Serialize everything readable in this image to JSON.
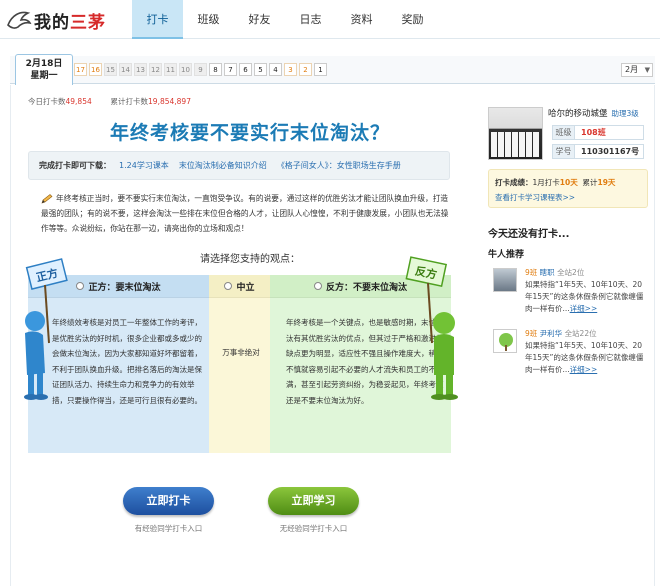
{
  "logo": {
    "text_a": "我的",
    "text_b": "三茅"
  },
  "nav": [
    "打卡",
    "班级",
    "好友",
    "日志",
    "资料",
    "奖励"
  ],
  "datebar": {
    "current_date": "2月18日",
    "current_weekday": "星期一",
    "days": [
      {
        "n": "17",
        "s": "orange"
      },
      {
        "n": "16",
        "s": "orange"
      },
      {
        "n": "15",
        "s": "grey"
      },
      {
        "n": "14",
        "s": "grey"
      },
      {
        "n": "13",
        "s": "grey"
      },
      {
        "n": "12",
        "s": "grey"
      },
      {
        "n": "11",
        "s": "grey"
      },
      {
        "n": "10",
        "s": "grey"
      },
      {
        "n": "9",
        "s": "grey"
      },
      {
        "n": "8",
        "s": "white"
      },
      {
        "n": "7",
        "s": "white"
      },
      {
        "n": "6",
        "s": "white"
      },
      {
        "n": "5",
        "s": "white"
      },
      {
        "n": "4",
        "s": "white"
      },
      {
        "n": "3",
        "s": "orange"
      },
      {
        "n": "2",
        "s": "orange"
      },
      {
        "n": "1",
        "s": "white"
      }
    ],
    "month": "2月"
  },
  "stats": {
    "today_label": "今日打卡数",
    "today_value": "49,854",
    "total_label": "累计打卡数",
    "total_value": "19,854,897"
  },
  "headline": "年终考核要不要实行末位淘汰？",
  "download": {
    "label": "完成打卡即可下载：",
    "links": [
      "1.24学习课本",
      "末位淘汰制必备知识介绍",
      "《格子间女人》：女性职场生存手册"
    ]
  },
  "intro": "年终考核正当时，要不要实行末位淘汰，一直饱受争议。有的说要，通过这样的优胜劣汰才能让团队换血升级，打造最强的团队；有的说不要，这样会淘汰一些排在末位但合格的人才，让团队人心惶惶，不利于健康发展，小团队也无法操作等等。众说纷纭，你站在那一边，请亮出你的立场和观点！",
  "choose": "请选择您支持的观点：",
  "debate": {
    "aff": {
      "title": "正方：要末位淘汰",
      "sign": "正方",
      "body": "年终绩效考核是对员工一年整体工作的考评，是优胜劣汰的好时机，很多企业都或多或少的会做末位淘汰，因为大家都知道好坏都留着，不利于团队换血升级。把排名落后的淘汰是保证团队活力、持续生命力和竞争力的有效举措，只要操作得当，还是可行且很有必要的。"
    },
    "neu": {
      "title": "中立",
      "body": "万事非绝对"
    },
    "neg": {
      "title": "反方：不要末位淘汰",
      "sign": "反方",
      "body": "年终考核是一个关键点，也是敏感时期，末位淘汰有其优胜劣汰的优点，但其过于严格和激进的缺点更为明显，适应性不强且操作难度大，稍有不慎就容易引起不必要的人才流失和员工的不满，甚至引起劳资纠纷，为稳妥起见，年终考核还是不要末位淘汰为好。"
    }
  },
  "buttons": {
    "checkin": "立即打卡",
    "study": "立即学习",
    "hint1": "有经验同学打卡入口",
    "hint2": "无经验同学打卡入口"
  },
  "sidebar": {
    "name": "哈尔的移动城堡",
    "assist": "助理3级",
    "class_key": "班级",
    "class_val": "108班",
    "id_key": "学号",
    "id_val": "110301167号",
    "score_label": "打卡成绩：",
    "month_label": "1月打卡",
    "month_val": "10天",
    "total_label": "累计",
    "total_val": "19天",
    "history_link": "查看打卡学习课程表>>",
    "today_title": "今天还没有打卡...",
    "rec_title": "牛人推荐",
    "recs": [
      {
        "cls": "9班",
        "name": "瞎职",
        "site": "全站2位",
        "text": "如果特指“1年5天、10年10天、20年15天”的这条休假条例它就像缠僵肉一样有价...",
        "more": "详细>>"
      },
      {
        "cls": "9班",
        "name": "尹利华",
        "site": "全站22位",
        "text": "如果特指“1年5天、10年10天、20年15天”的这条休假条例它就像缠僵肉一样有价...",
        "more": "详细>>"
      }
    ]
  },
  "colors": {
    "accent": "#1c7bb5",
    "orange": "#e07d10",
    "link": "#2a6fb0"
  }
}
